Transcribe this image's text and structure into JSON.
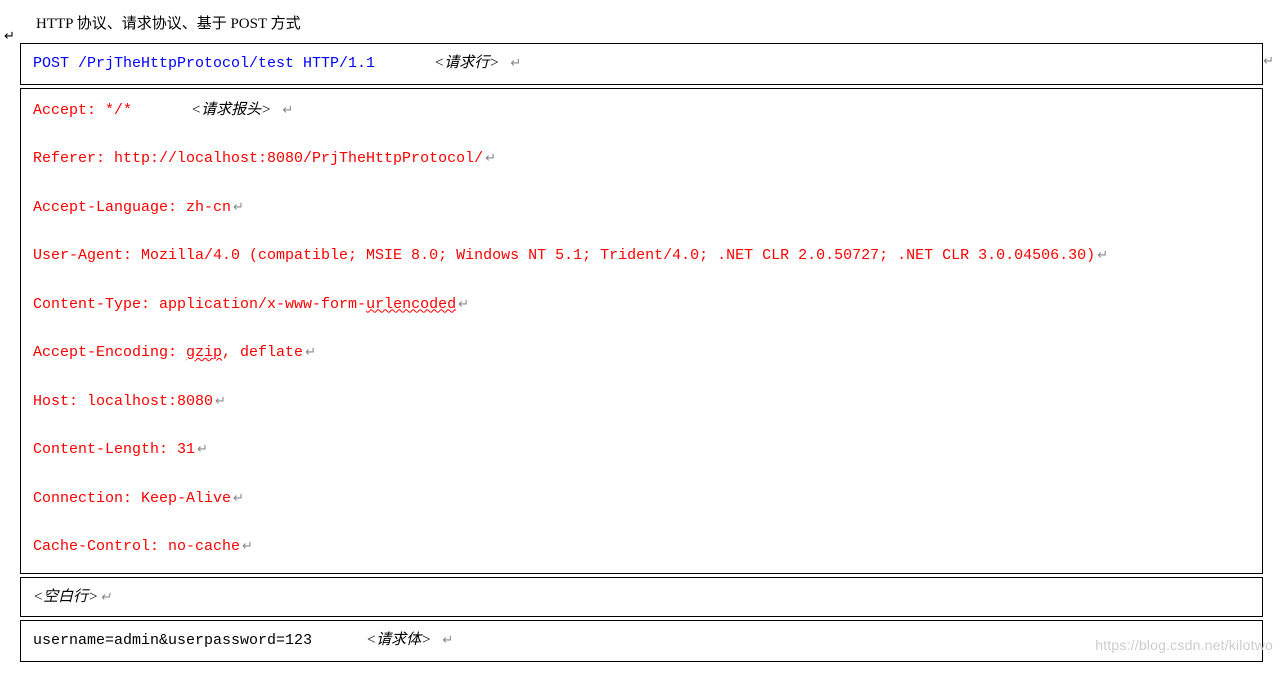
{
  "title": "HTTP 协议、请求协议、基于 POST 方式",
  "cursor_mark": "↵",
  "request_line": {
    "text": "POST /PrjTheHttpProtocol/test HTTP/1.1",
    "annotation": "<请求行>",
    "return_sym": "↵"
  },
  "headers": {
    "accept": {
      "label": "Accept: */*",
      "annotation": "<请求报头>",
      "return_sym": "↵"
    },
    "referer": {
      "label": "Referer: http://localhost:8080/PrjTheHttpProtocol/",
      "return_sym": "↵"
    },
    "accept_language": {
      "label": "Accept-Language: zh-cn",
      "return_sym": "↵"
    },
    "user_agent": {
      "label": "User-Agent: Mozilla/4.0 (compatible; MSIE 8.0; Windows NT 5.1; Trident/4.0; .NET CLR 2.0.50727; .NET CLR 3.0.04506.30)",
      "return_sym": "↵"
    },
    "content_type": {
      "prefix": "Content-Type: application/x-www-form-",
      "wavy": "urlencoded",
      "return_sym": "↵"
    },
    "accept_encoding": {
      "prefix": "Accept-Encoding: ",
      "wavy": "gzip",
      "suffix": ", deflate",
      "return_sym": "↵"
    },
    "host": {
      "label": "Host: localhost:8080",
      "return_sym": "↵"
    },
    "content_length": {
      "label": "Content-Length: 31",
      "return_sym": "↵"
    },
    "connection": {
      "label": "Connection: Keep-Alive",
      "return_sym": "↵"
    },
    "cache_control": {
      "label": "Cache-Control: no-cache",
      "return_sym": "↵"
    }
  },
  "blank_line": {
    "annotation": "<空白行>",
    "return_sym": "↵"
  },
  "body": {
    "text": "username=admin&userpassword=123",
    "annotation": "<请求体>",
    "return_sym": "↵"
  },
  "watermark": "https://blog.csdn.net/kilotwo"
}
